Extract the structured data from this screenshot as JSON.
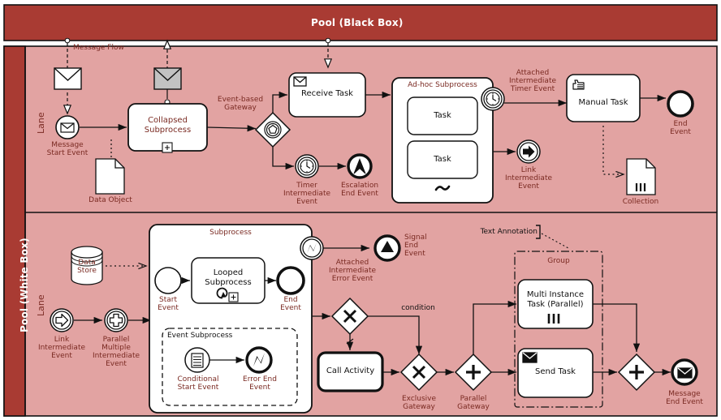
{
  "diagram": {
    "type": "BPMN 2.0 notation reference diagram",
    "pools": [
      {
        "id": "black_box",
        "title": "Pool (Black Box)",
        "style": "collapsed"
      },
      {
        "id": "white_box",
        "title": "Pool (White Box)",
        "style": "expanded",
        "lanes": [
          {
            "title": "Lane"
          },
          {
            "title": "Lane"
          }
        ]
      }
    ],
    "colors": {
      "pool_header": "#A93B33",
      "lane_background": "#E2A3A2",
      "label_text": "#7A2A22",
      "dark_text": "#111111",
      "shape_fill": "#FFFFFF",
      "shape_stroke": "#111111",
      "message_icon_fill_receive": "#C2C2C2"
    },
    "connector_labels": {
      "message_flow": "Message Flow",
      "condition": "condition"
    },
    "lane1": {
      "elements": [
        {
          "name": "message-start-event",
          "label": "Message\nStart Event",
          "shape": "start-event-message"
        },
        {
          "name": "data-object",
          "label": "Data Object",
          "shape": "data-object"
        },
        {
          "name": "collapsed-subprocess",
          "label": "Collapsed\nSubprocess",
          "shape": "collapsed-subprocess",
          "marker": "+"
        },
        {
          "name": "event-based-gateway",
          "label": "Event-based\nGateway",
          "shape": "event-based-gateway"
        },
        {
          "name": "receive-task",
          "label": "Receive Task",
          "shape": "task-receive"
        },
        {
          "name": "timer-intermediate-event",
          "label": "Timer\nIntermediate\nEvent",
          "shape": "intermediate-timer"
        },
        {
          "name": "escalation-end-event",
          "label": "Escalation\nEnd Event",
          "shape": "end-escalation"
        },
        {
          "name": "adhoc-subprocess",
          "label": "Ad-hoc Subprocess",
          "shape": "adhoc-subprocess",
          "marker": "~",
          "children": [
            {
              "label": "Task"
            },
            {
              "label": "Task"
            }
          ]
        },
        {
          "name": "attached-intermediate-timer-event",
          "label": "Attached\nIntermediate\nTimer Event",
          "shape": "boundary-timer"
        },
        {
          "name": "link-intermediate-event",
          "label": "Link\nIntermediate\nEvent",
          "shape": "intermediate-link"
        },
        {
          "name": "manual-task",
          "label": "Manual Task",
          "shape": "task-manual"
        },
        {
          "name": "end-event",
          "label": "End\nEvent",
          "shape": "end-event"
        },
        {
          "name": "collection",
          "label": "Collection",
          "shape": "data-collection"
        }
      ]
    },
    "lane2": {
      "elements": [
        {
          "name": "data-store",
          "label": "Data\nStore",
          "shape": "data-store"
        },
        {
          "name": "link-intermediate-event-2",
          "label": "Link\nIntermediate\nEvent",
          "shape": "intermediate-link"
        },
        {
          "name": "parallel-multiple-intermediate-event",
          "label": "Parallel\nMultiple\nIntermediate\nEvent",
          "shape": "intermediate-parallel-multiple"
        },
        {
          "name": "subprocess",
          "label": "Subprocess",
          "shape": "expanded-subprocess"
        },
        {
          "name": "start-event",
          "label": "Start\nEvent",
          "shape": "start-event"
        },
        {
          "name": "looped-subprocess",
          "label": "Looped\nSubprocess",
          "shape": "looped-subprocess",
          "marker": "+"
        },
        {
          "name": "end-event-2",
          "label": "End\nEvent",
          "shape": "end-event"
        },
        {
          "name": "event-subprocess",
          "label": "Event Subprocess",
          "shape": "event-subprocess"
        },
        {
          "name": "conditional-start-event",
          "label": "Conditional\nStart Event",
          "shape": "start-event-conditional"
        },
        {
          "name": "error-end-event",
          "label": "Error End\nEvent",
          "shape": "end-error"
        },
        {
          "name": "attached-intermediate-error-event",
          "label": "Attached\nIntermediate\nError Event",
          "shape": "boundary-error"
        },
        {
          "name": "signal-end-event",
          "label": "Signal\nEnd\nEvent",
          "shape": "end-signal"
        },
        {
          "name": "exclusive-gateway-top",
          "label": "",
          "shape": "exclusive-gateway"
        },
        {
          "name": "call-activity",
          "label": "Call Activity",
          "shape": "call-activity"
        },
        {
          "name": "exclusive-gateway",
          "label": "Exclusive\nGateway",
          "shape": "exclusive-gateway"
        },
        {
          "name": "parallel-gateway",
          "label": "Parallel\nGateway",
          "shape": "parallel-gateway"
        },
        {
          "name": "text-annotation",
          "label": "Text Annotation",
          "shape": "text-annotation"
        },
        {
          "name": "group",
          "label": "Group",
          "shape": "group"
        },
        {
          "name": "multi-instance-task",
          "label": "Multi Instance\nTask (Parallel)",
          "shape": "task-multi-instance"
        },
        {
          "name": "send-task",
          "label": "Send Task",
          "shape": "task-send"
        },
        {
          "name": "parallel-gateway-join",
          "label": "",
          "shape": "parallel-gateway"
        },
        {
          "name": "message-end-event",
          "label": "Message\nEnd Event",
          "shape": "end-message"
        }
      ]
    }
  }
}
